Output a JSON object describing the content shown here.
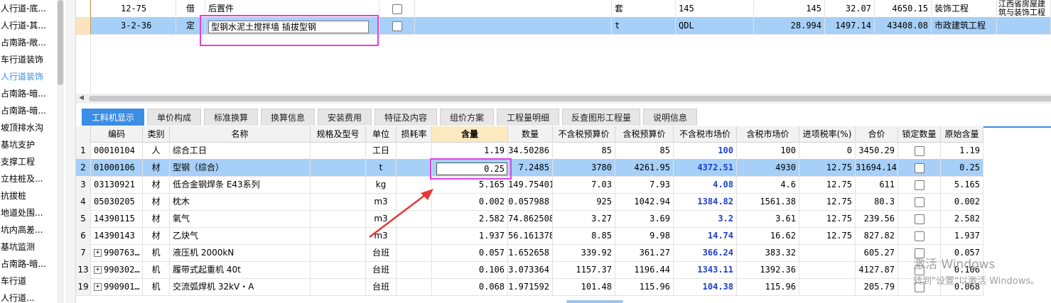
{
  "left_tree": {
    "items": [
      "人行道-底...",
      "人行道-其...",
      "占南路-敞...",
      "车行道装饰",
      "人行道装饰",
      "占南路-暗...",
      "占南路-暗...",
      "坡顶排水沟",
      "基坑支护",
      "支撑工程",
      "立柱桩及...",
      "抗拔桩",
      "地道处围...",
      "坑内高差...",
      "基坑监测",
      "占南路-暗...",
      "车行道",
      "人行道..."
    ],
    "active_index": 4
  },
  "top_grid": {
    "rows": [
      {
        "code": "12-75",
        "type": "借",
        "name": "后置件",
        "unit": "套",
        "expr": "145",
        "qty": "145",
        "price": "32.07",
        "total": "4650.15",
        "category": "装饰工程",
        "note": "江西省房屋建筑与装饰工程消耗量定额及统一基价表"
      },
      {
        "code": "3-2-36",
        "type": "定",
        "name": "型钢水泥土搅拌墙 插拔型钢",
        "unit": "t",
        "expr": "QDL",
        "qty": "28.994",
        "price": "1497.14",
        "total": "43408.08",
        "category": "市政建筑工程",
        "note": ""
      }
    ]
  },
  "tabs": [
    "工料机显示",
    "单价构成",
    "标准换算",
    "换算信息",
    "安装费用",
    "特征及内容",
    "组价方案",
    "工程量明细",
    "反查图形工程量",
    "说明信息"
  ],
  "bottom_grid": {
    "headers": [
      "",
      "编码",
      "类别",
      "名称",
      "规格及型号",
      "单位",
      "损耗率",
      "含量",
      "数量",
      "不含税预算价",
      "含税预算价",
      "不含税市场价",
      "含税市场价",
      "进项税率(%)",
      "合价",
      "锁定数量",
      "原始含量"
    ],
    "rows": [
      {
        "idx": "1",
        "code": "00010104",
        "cat": "人",
        "name": "综合工日",
        "spec": "",
        "unit": "工日",
        "loss": "",
        "qty_per": "1.19",
        "qty": "34.50286",
        "pre_ex": "85",
        "pre_in": "85",
        "mkt_ex": "100",
        "mkt_in": "100",
        "tax": "0",
        "total": "3450.29",
        "orig": "1.19",
        "expand": false
      },
      {
        "idx": "2",
        "code": "01000106",
        "cat": "材",
        "name": "型钢（综合）",
        "spec": "",
        "unit": "t",
        "loss": "",
        "qty_per": "0.25",
        "qty": "7.2485",
        "pre_ex": "3780",
        "pre_in": "4261.95",
        "mkt_ex": "4372.51",
        "mkt_in": "4930",
        "tax": "12.75",
        "total": "31694.14",
        "orig": "0.25",
        "expand": false
      },
      {
        "idx": "3",
        "code": "03130921",
        "cat": "材",
        "name": "低合金钢焊条 E43系列",
        "spec": "",
        "unit": "kg",
        "loss": "",
        "qty_per": "5.165",
        "qty": "149.75401",
        "pre_ex": "7.03",
        "pre_in": "7.93",
        "mkt_ex": "4.08",
        "mkt_in": "4.6",
        "tax": "12.75",
        "total": "611",
        "orig": "5.165",
        "expand": false
      },
      {
        "idx": "4",
        "code": "05030205",
        "cat": "材",
        "name": "枕木",
        "spec": "",
        "unit": "m3",
        "loss": "",
        "qty_per": "0.002",
        "qty": "0.057988",
        "pre_ex": "925",
        "pre_in": "1042.94",
        "mkt_ex": "1384.82",
        "mkt_in": "1561.38",
        "tax": "12.75",
        "total": "80.3",
        "orig": "0.002",
        "expand": false
      },
      {
        "idx": "5",
        "code": "14390115",
        "cat": "材",
        "name": "氧气",
        "spec": "",
        "unit": "m3",
        "loss": "",
        "qty_per": "2.582",
        "qty": "74.862508",
        "pre_ex": "3.27",
        "pre_in": "3.69",
        "mkt_ex": "3.2",
        "mkt_in": "3.61",
        "tax": "12.75",
        "total": "239.56",
        "orig": "2.582",
        "expand": false
      },
      {
        "idx": "6",
        "code": "14390143",
        "cat": "材",
        "name": "乙炔气",
        "spec": "",
        "unit": "m3",
        "loss": "",
        "qty_per": "1.937",
        "qty": "56.161378",
        "pre_ex": "8.85",
        "pre_in": "9.98",
        "mkt_ex": "14.74",
        "mkt_in": "16.62",
        "tax": "12.75",
        "total": "827.82",
        "orig": "1.937",
        "expand": false
      },
      {
        "idx": "7",
        "code": "990763…",
        "cat": "机",
        "name": "液压机 2000kN",
        "spec": "",
        "unit": "台班",
        "loss": "",
        "qty_per": "0.057",
        "qty": "1.652658",
        "pre_ex": "339.92",
        "pre_in": "361.27",
        "mkt_ex": "366.24",
        "mkt_in": "383.32",
        "tax": "",
        "total": "605.27",
        "orig": "0.057",
        "expand": true
      },
      {
        "idx": "13",
        "code": "990302…",
        "cat": "机",
        "name": "履带式起重机 40t",
        "spec": "",
        "unit": "台班",
        "loss": "",
        "qty_per": "0.106",
        "qty": "3.073364",
        "pre_ex": "1157.37",
        "pre_in": "1196.44",
        "mkt_ex": "1343.11",
        "mkt_in": "1392.36",
        "tax": "",
        "total": "4127.87",
        "orig": "0.106",
        "expand": true
      },
      {
        "idx": "19",
        "code": "990901…",
        "cat": "机",
        "name": "交流弧焊机 32kV・A",
        "spec": "",
        "unit": "台班",
        "loss": "",
        "qty_per": "0.068",
        "qty": "1.971592",
        "pre_ex": "101.48",
        "pre_in": "115.96",
        "mkt_ex": "104.38",
        "mkt_in": "115.96",
        "tax": "",
        "total": "205.79",
        "orig": "0.068",
        "expand": true
      }
    ]
  },
  "watermark": {
    "line1": "激活 Windows",
    "line2": "转到\"设置\"以激活 Windows。"
  },
  "colors": {
    "selection": "#a6d0f7",
    "accent": "#3a8ee6",
    "highlight_box": "#e040e0",
    "arrow": "#e53935",
    "market_price": "#1f3fd0"
  }
}
